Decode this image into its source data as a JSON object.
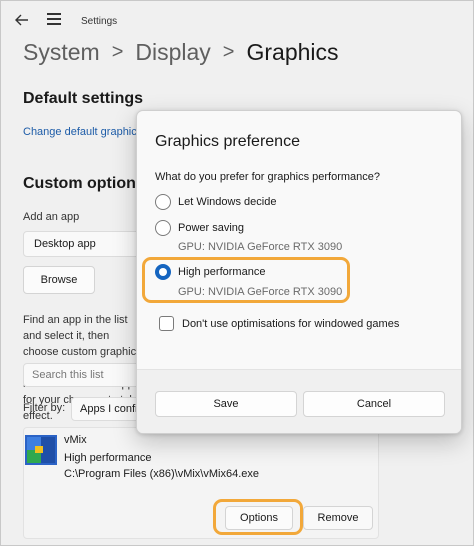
{
  "window": {
    "title": "Settings",
    "breadcrumb": [
      "System",
      "Display",
      "Graphics"
    ],
    "breadcrumb_separator": ">"
  },
  "default_settings": {
    "heading": "Default settings",
    "link": "Change default graphics settings"
  },
  "custom_options": {
    "heading": "Custom options for apps",
    "add_label": "Add an app",
    "app_type_value": "Desktop app",
    "browse_label": "Browse",
    "description": "Find an app in the list and select it, then choose custom graphics settings for it. You might need to restart the app for your changes to take effect.",
    "search_placeholder": "Search this list",
    "filter_label": "Filter by:",
    "filter_value": "Apps I configured"
  },
  "app_entry": {
    "name": "vMix",
    "preference": "High performance",
    "path": "C:\\Program Files (x86)\\vMix\\vMix64.exe",
    "options_label": "Options",
    "remove_label": "Remove"
  },
  "dialog": {
    "title": "Graphics preference",
    "question": "What do you prefer for graphics performance?",
    "options": [
      {
        "label": "Let Windows decide",
        "gpu": "",
        "selected": false
      },
      {
        "label": "Power saving",
        "gpu": "GPU: NVIDIA GeForce RTX 3090",
        "selected": false
      },
      {
        "label": "High performance",
        "gpu": "GPU: NVIDIA GeForce RTX 3090",
        "selected": true
      }
    ],
    "checkbox_label": "Don't use optimisations for windowed games",
    "checkbox_checked": false,
    "save_label": "Save",
    "cancel_label": "Cancel"
  },
  "colors": {
    "accent": "#1565c0",
    "highlight": "#f2a83a",
    "link": "#1d5ca8"
  }
}
